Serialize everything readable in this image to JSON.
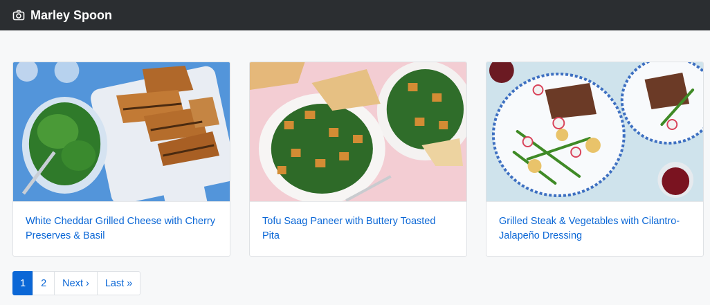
{
  "brand": {
    "name": "Marley Spoon",
    "icon": "camera-icon"
  },
  "recipes": [
    {
      "title": "White Cheddar Grilled Cheese with Cherry Preserves & Basil",
      "image": "grilled-cheese-photo"
    },
    {
      "title": "Tofu Saag Paneer with Buttery Toasted Pita",
      "image": "saag-paneer-photo"
    },
    {
      "title": "Grilled Steak & Vegetables with Cilantro-Jalapeño Dressing",
      "image": "steak-vegetables-photo"
    }
  ],
  "pagination": {
    "current": "1",
    "page2": "2",
    "next": "Next ›",
    "last": "Last »"
  },
  "colors": {
    "navbar": "#2b2e31",
    "link": "#0b67d6",
    "page_bg": "#f7f8f9"
  }
}
